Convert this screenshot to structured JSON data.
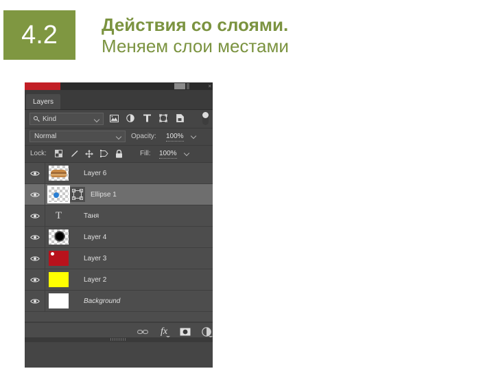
{
  "slide": {
    "badge_number": "4.2",
    "title_line_1": "Действия со слоями.",
    "title_line_2": "Меняем слои местами",
    "accent_color": "#7f9741"
  },
  "photoshop_panel": {
    "app_bar": {
      "close_label": "×"
    },
    "tabs": [
      {
        "label": "Layers",
        "active": true
      }
    ],
    "filter_row": {
      "kind_label": "Kind",
      "search_icon": "search-icon",
      "icons": [
        "pixel-layer-filter-icon",
        "adjustment-layer-filter-icon",
        "type-layer-filter-icon",
        "shape-layer-filter-icon",
        "smart-object-filter-icon"
      ],
      "toggle_label": "filter-toggle-switch"
    },
    "blend_row": {
      "blend_mode": "Normal",
      "opacity_label": "Opacity:",
      "opacity_value": "100%"
    },
    "lock_row": {
      "lock_label": "Lock:",
      "icons": [
        "lock-transparent-pixels-icon",
        "lock-image-pixels-icon",
        "lock-position-icon",
        "lock-artboard-nesting-icon",
        "lock-all-icon"
      ],
      "fill_label": "Fill:",
      "fill_value": "100%"
    },
    "layers": [
      {
        "name": "Layer 6",
        "visible": true,
        "selected": false,
        "thumb": "burger-image",
        "italic": false
      },
      {
        "name": "Ellipse 1",
        "visible": true,
        "selected": true,
        "thumb": "blue-ellipse-vector",
        "italic": false
      },
      {
        "name": "Таня",
        "visible": true,
        "selected": false,
        "thumb": "type-layer-T",
        "italic": false
      },
      {
        "name": "Layer 4",
        "visible": true,
        "selected": false,
        "thumb": "black-blurred-circle",
        "italic": false
      },
      {
        "name": "Layer 3",
        "visible": true,
        "selected": false,
        "thumb": "dark-red-fill",
        "italic": false
      },
      {
        "name": "Layer 2",
        "visible": true,
        "selected": false,
        "thumb": "yellow-fill",
        "italic": false
      },
      {
        "name": "Background",
        "visible": true,
        "selected": false,
        "thumb": "white-fill",
        "italic": true
      }
    ],
    "bottom_toolbar": {
      "icons": [
        "link-layers-icon",
        "layer-style-fx-icon",
        "add-layer-mask-icon",
        "new-adjustment-layer-icon"
      ],
      "fx_label": "fx"
    }
  }
}
